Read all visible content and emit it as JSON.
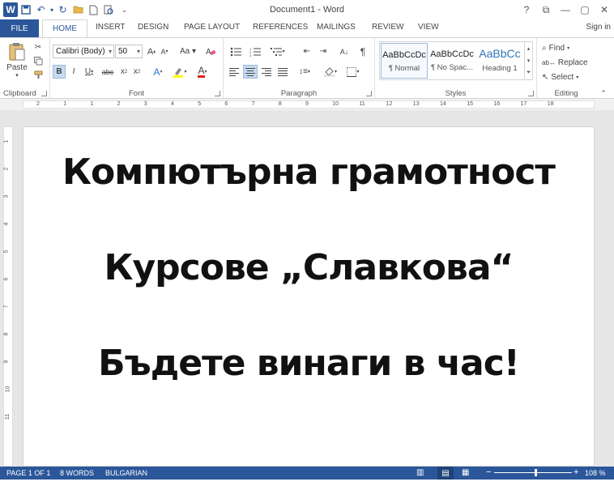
{
  "window": {
    "title": "Document1 - Word",
    "controls": [
      "?",
      "⧉",
      "—",
      "▢",
      "✕"
    ]
  },
  "qat_icons": [
    "word-icon",
    "save-icon",
    "undo-icon",
    "redo-icon",
    "open-icon",
    "new-icon",
    "print-preview-icon",
    "customize-icon"
  ],
  "tabs": {
    "file": "FILE",
    "home": "HOME",
    "insert": "INSERT",
    "design": "DESIGN",
    "page_layout": "PAGE LAYOUT",
    "references": "REFERENCES",
    "mailings": "MAILINGS",
    "review": "REVIEW",
    "view": "VIEW",
    "sign_in": "Sign in"
  },
  "ribbon": {
    "clipboard": {
      "label": "Clipboard",
      "paste": "Paste"
    },
    "font": {
      "label": "Font",
      "font_name": "Calibri (Body)",
      "font_size": "50"
    },
    "paragraph": {
      "label": "Paragraph"
    },
    "styles": {
      "label": "Styles",
      "items": [
        {
          "preview": "AaBbCcDc",
          "name": "¶ Normal"
        },
        {
          "preview": "AaBbCcDc",
          "name": "¶ No Spac..."
        },
        {
          "preview": "AaBbCc",
          "name": "Heading 1"
        }
      ]
    },
    "editing": {
      "label": "Editing",
      "find": "Find",
      "replace": "Replace",
      "select": "Select"
    }
  },
  "ruler_numbers": [
    "2",
    "1",
    "1",
    "2",
    "3",
    "4",
    "5",
    "6",
    "7",
    "8",
    "9",
    "10",
    "11",
    "12",
    "13",
    "14",
    "15",
    "16",
    "17",
    "18"
  ],
  "vruler_numbers": [
    "1",
    "2",
    "3",
    "4",
    "5",
    "6",
    "7",
    "8",
    "9",
    "10",
    "11"
  ],
  "document": {
    "lines": [
      "Компютърна грамотност",
      "Курсове „Славкова“",
      "Бъдете винаги в час!"
    ]
  },
  "status": {
    "page": "PAGE 1 OF 1",
    "words": "8 WORDS",
    "language": "BULGARIAN",
    "zoom": "108 %"
  },
  "colors": {
    "accent": "#2b579a"
  }
}
